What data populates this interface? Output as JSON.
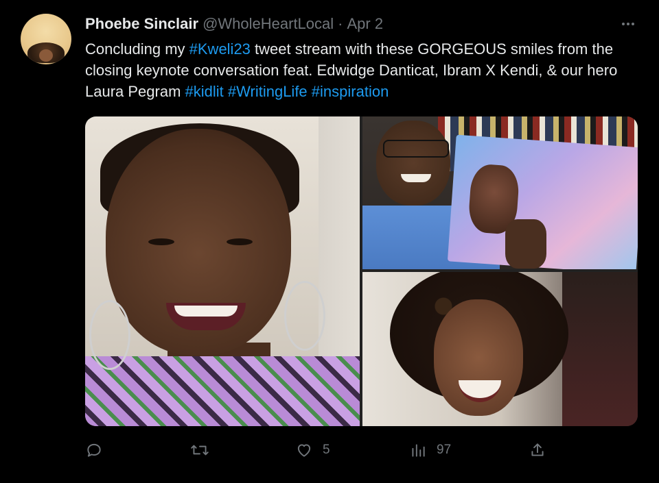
{
  "author": {
    "name": "Phoebe Sinclair",
    "handle": "@WholeHeartLocal",
    "separator": "·",
    "date": "Apr 2"
  },
  "tweet": {
    "t1": "Concluding my ",
    "h1": "#Kweli23",
    "t2": " tweet stream with these GORGEOUS smiles from the closing keynote conversation feat. Edwidge Danticat, Ibram X Kendi, & our hero Laura Pegram ",
    "h2": "#kidlit",
    "h3": "#WritingLife",
    "h4": "#inspiration"
  },
  "actions": {
    "reply": {
      "icon": "reply-icon",
      "count": ""
    },
    "retweet": {
      "icon": "retweet-icon",
      "count": ""
    },
    "like": {
      "icon": "heart-icon",
      "count": "5"
    },
    "views": {
      "icon": "analytics-icon",
      "count": "97"
    },
    "share": {
      "icon": "share-icon"
    }
  },
  "colors": {
    "background": "#000000",
    "text": "#e7e9ea",
    "muted": "#71767b",
    "hashtag": "#1d9bf0"
  }
}
